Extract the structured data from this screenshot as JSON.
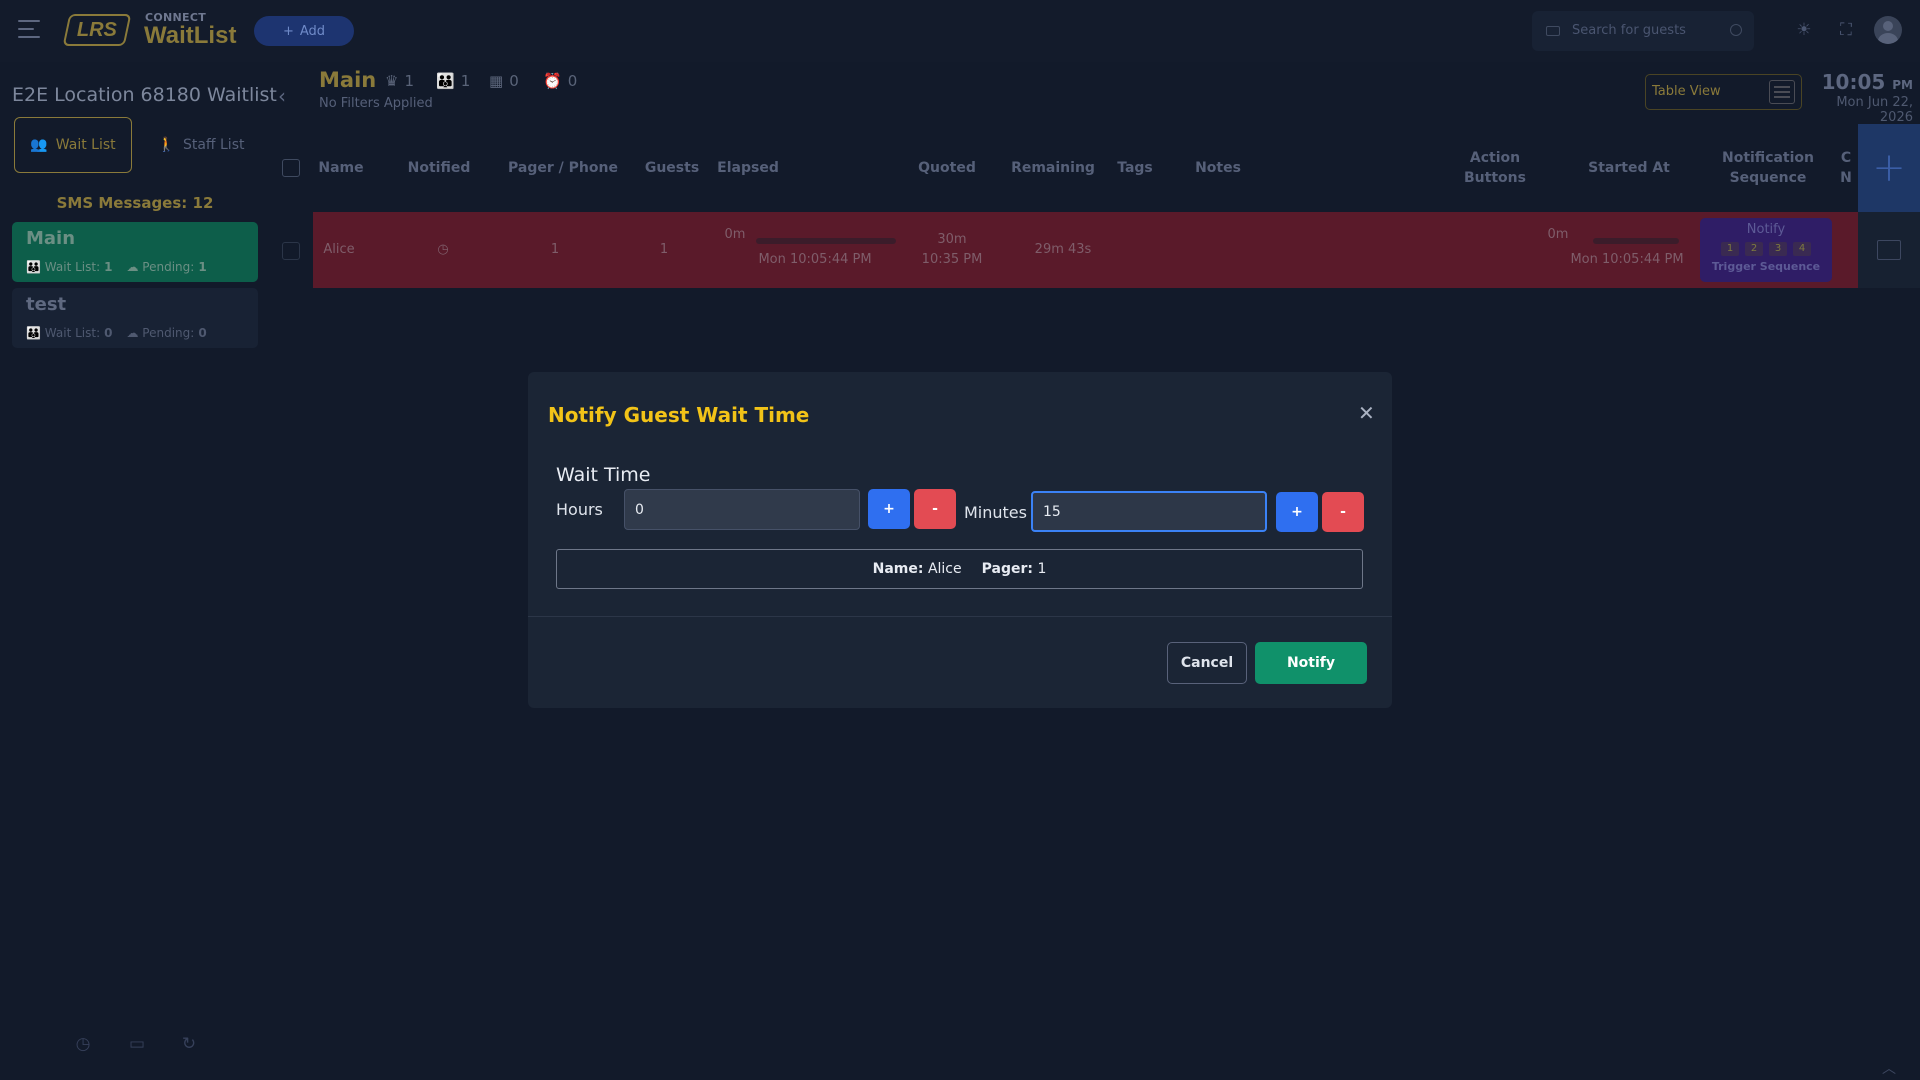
{
  "app": {
    "brand_top": "CONNECT",
    "brand_main": "WaitList",
    "logo_text": "LRS",
    "add_label": "Add"
  },
  "search": {
    "placeholder": "Search for guests"
  },
  "sidebar": {
    "location": "E2E Location 68180 Waitlist",
    "tabs": [
      {
        "label": "Wait List",
        "active": true
      },
      {
        "label": "Staff List",
        "active": false
      }
    ],
    "sms_label": "SMS Messages: 12",
    "waitlists": [
      {
        "name": "Main",
        "waitlist_label": "Wait List:",
        "waitlist_count": "1",
        "pending_label": "Pending:",
        "pending_count": "1",
        "active": true
      },
      {
        "name": "test",
        "waitlist_label": "Wait List:",
        "waitlist_count": "0",
        "pending_label": "Pending:",
        "pending_count": "0",
        "active": false
      }
    ]
  },
  "main": {
    "title": "Main",
    "stats": [
      "1",
      "1",
      "0",
      "0"
    ],
    "filters": "No Filters Applied",
    "view_label": "Table View",
    "clock_time": "10:05",
    "clock_ampm": "PM",
    "clock_date": "Mon Jun 22, 2026",
    "columns": [
      "Name",
      "Notified",
      "Pager / Phone",
      "Guests",
      "Elapsed",
      "Quoted",
      "Remaining",
      "Tags",
      "Notes",
      "Action Buttons",
      "Started At",
      "Notification Sequence",
      "C N"
    ],
    "rows": [
      {
        "name": "Alice",
        "pager": "1",
        "guests": "1",
        "elapsed": "0m",
        "elapsed_time": "Mon 10:05:44 PM",
        "quoted": "30m",
        "quoted_time": "10:35 PM",
        "remaining": "29m 43s",
        "started": "0m",
        "started_time": "Mon 10:05:44 PM",
        "notify_title": "Notify",
        "steps": [
          "1",
          "2",
          "3",
          "4"
        ],
        "trigger": "Trigger Sequence"
      }
    ]
  },
  "modal": {
    "title": "Notify Guest Wait Time",
    "wait_label": "Wait Time",
    "hours_label": "Hours",
    "hours_value": "0",
    "minutes_label": "Minutes",
    "minutes_value": "15",
    "plus": "+",
    "minus": "-",
    "name_label": "Name:",
    "name_value": "Alice",
    "pager_label": "Pager:",
    "pager_value": "1",
    "cancel": "Cancel",
    "notify": "Notify"
  },
  "colors": {
    "accent": "#f2c318",
    "primary": "#2f6ff0",
    "danger": "#e34b53",
    "success": "#10916a"
  }
}
